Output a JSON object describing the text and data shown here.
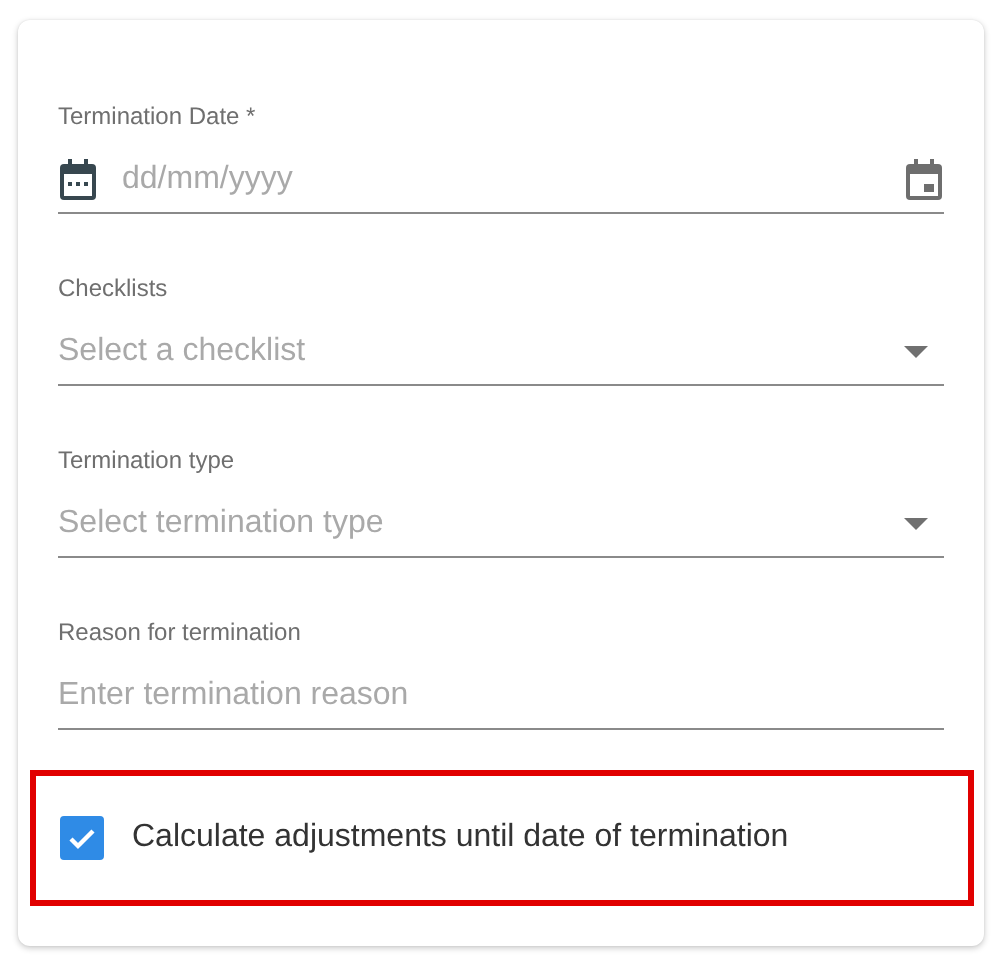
{
  "fields": [
    {
      "kind": "date",
      "label": "Termination Date *",
      "placeholder": "dd/mm/yyyy"
    },
    {
      "kind": "select",
      "label": "Checklists",
      "placeholder": "Select a checklist"
    },
    {
      "kind": "select",
      "label": "Termination type",
      "placeholder": "Select termination type"
    },
    {
      "kind": "text",
      "label": "Reason for termination",
      "placeholder": "Enter termination reason"
    }
  ],
  "option": {
    "label": "Calculate adjustments until date of termination",
    "checked": true,
    "highlighted": true
  }
}
